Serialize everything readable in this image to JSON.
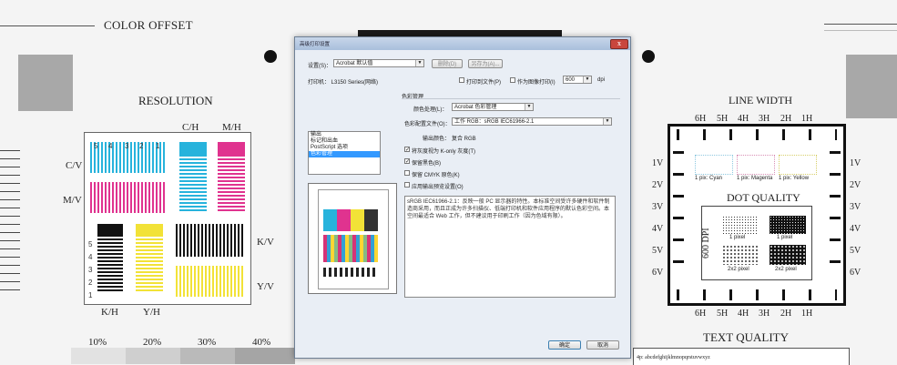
{
  "background": {
    "color_offset_label": "COLOR OFFSET",
    "resolution_label": "RESOLUTION",
    "line_width_label": "LINE WIDTH",
    "dot_quality_label": "DOT QUALITY",
    "text_quality_label": "TEXT QUALITY",
    "dpi_label": "600 DPI",
    "color_labels": {
      "c_h": "C/H",
      "m_h": "M/H",
      "c_v": "C/V",
      "m_v": "M/V",
      "k_v": "K/V",
      "y_v": "Y/V",
      "k_h": "K/H",
      "y_h": "Y/H"
    },
    "res_numbers": [
      "5",
      "4",
      "3",
      "2",
      "1"
    ],
    "percentages": [
      "10%",
      "20%",
      "30%",
      "40%"
    ],
    "line_width_top": [
      "6H",
      "5H",
      "4H",
      "3H",
      "2H",
      "1H"
    ],
    "line_width_bottom": [
      "6H",
      "5H",
      "4H",
      "3H",
      "2H",
      "1H"
    ],
    "line_width_left": [
      "1V",
      "2V",
      "3V",
      "4V",
      "5V",
      "6V"
    ],
    "line_width_right": [
      "1V",
      "2V",
      "3V",
      "4V",
      "5V",
      "6V"
    ],
    "pix_labels": [
      "1 pix: Cyan",
      "1 pix: Magenta",
      "1 pix: Yellow"
    ],
    "dot_labels": [
      "1 pixel",
      "1 pixel",
      "2x2 pixel",
      "2x2 pixel"
    ],
    "text_quality_sample": "4p: abcdefghijklmnopqrstuvwxyz"
  },
  "dialog": {
    "title": "高级打印设置",
    "close_label": "x",
    "settings_label": "设置(S)：",
    "settings_value": "Acrobat 默认值",
    "delete_button": "删除(D)",
    "save_as_button": "另存为(A)...",
    "printer_label": "打印机：  L3150 Series(网络)",
    "print_to_file_label": "打印到文件(P)",
    "print_as_image_label": "作为图像打印(I)",
    "dpi_value": "600",
    "dpi_unit": "dpi",
    "list_items": [
      "输出",
      "标记和出血",
      "PostScript 选项",
      "色彩管理"
    ],
    "color_management_header": "色彩管理",
    "color_handling_label": "颜色处理(L)：",
    "color_handling_value": "Acrobat 色彩管理",
    "color_profile_label": "色彩配置文件(O)：",
    "color_profile_value": "工作 RGB：sRGB IEC61966-2.1",
    "output_color_label": "输出颜色：",
    "output_color_value": "复合 RGB",
    "checkbox_items": [
      "将灰度视为 K-only 灰度(T)",
      "保留黑色(B)",
      "保留 CMYK 原色(K)",
      "应用输出预览设置(O)"
    ],
    "checkbox_states": [
      true,
      true,
      false,
      false
    ],
    "description": "sRGB IEC61966-2.1：反映一般 PC 显示器的特性。本标准空间受许多硬件和软件制造商采用，而且正成为许多扫描仪、低端打印机和软件应用程序的默认色彩空间。本空间最适合 Web 工作，但不建议用于印刷工作（因为色域有限）。",
    "ok_button": "确定",
    "cancel_button": "取消"
  }
}
